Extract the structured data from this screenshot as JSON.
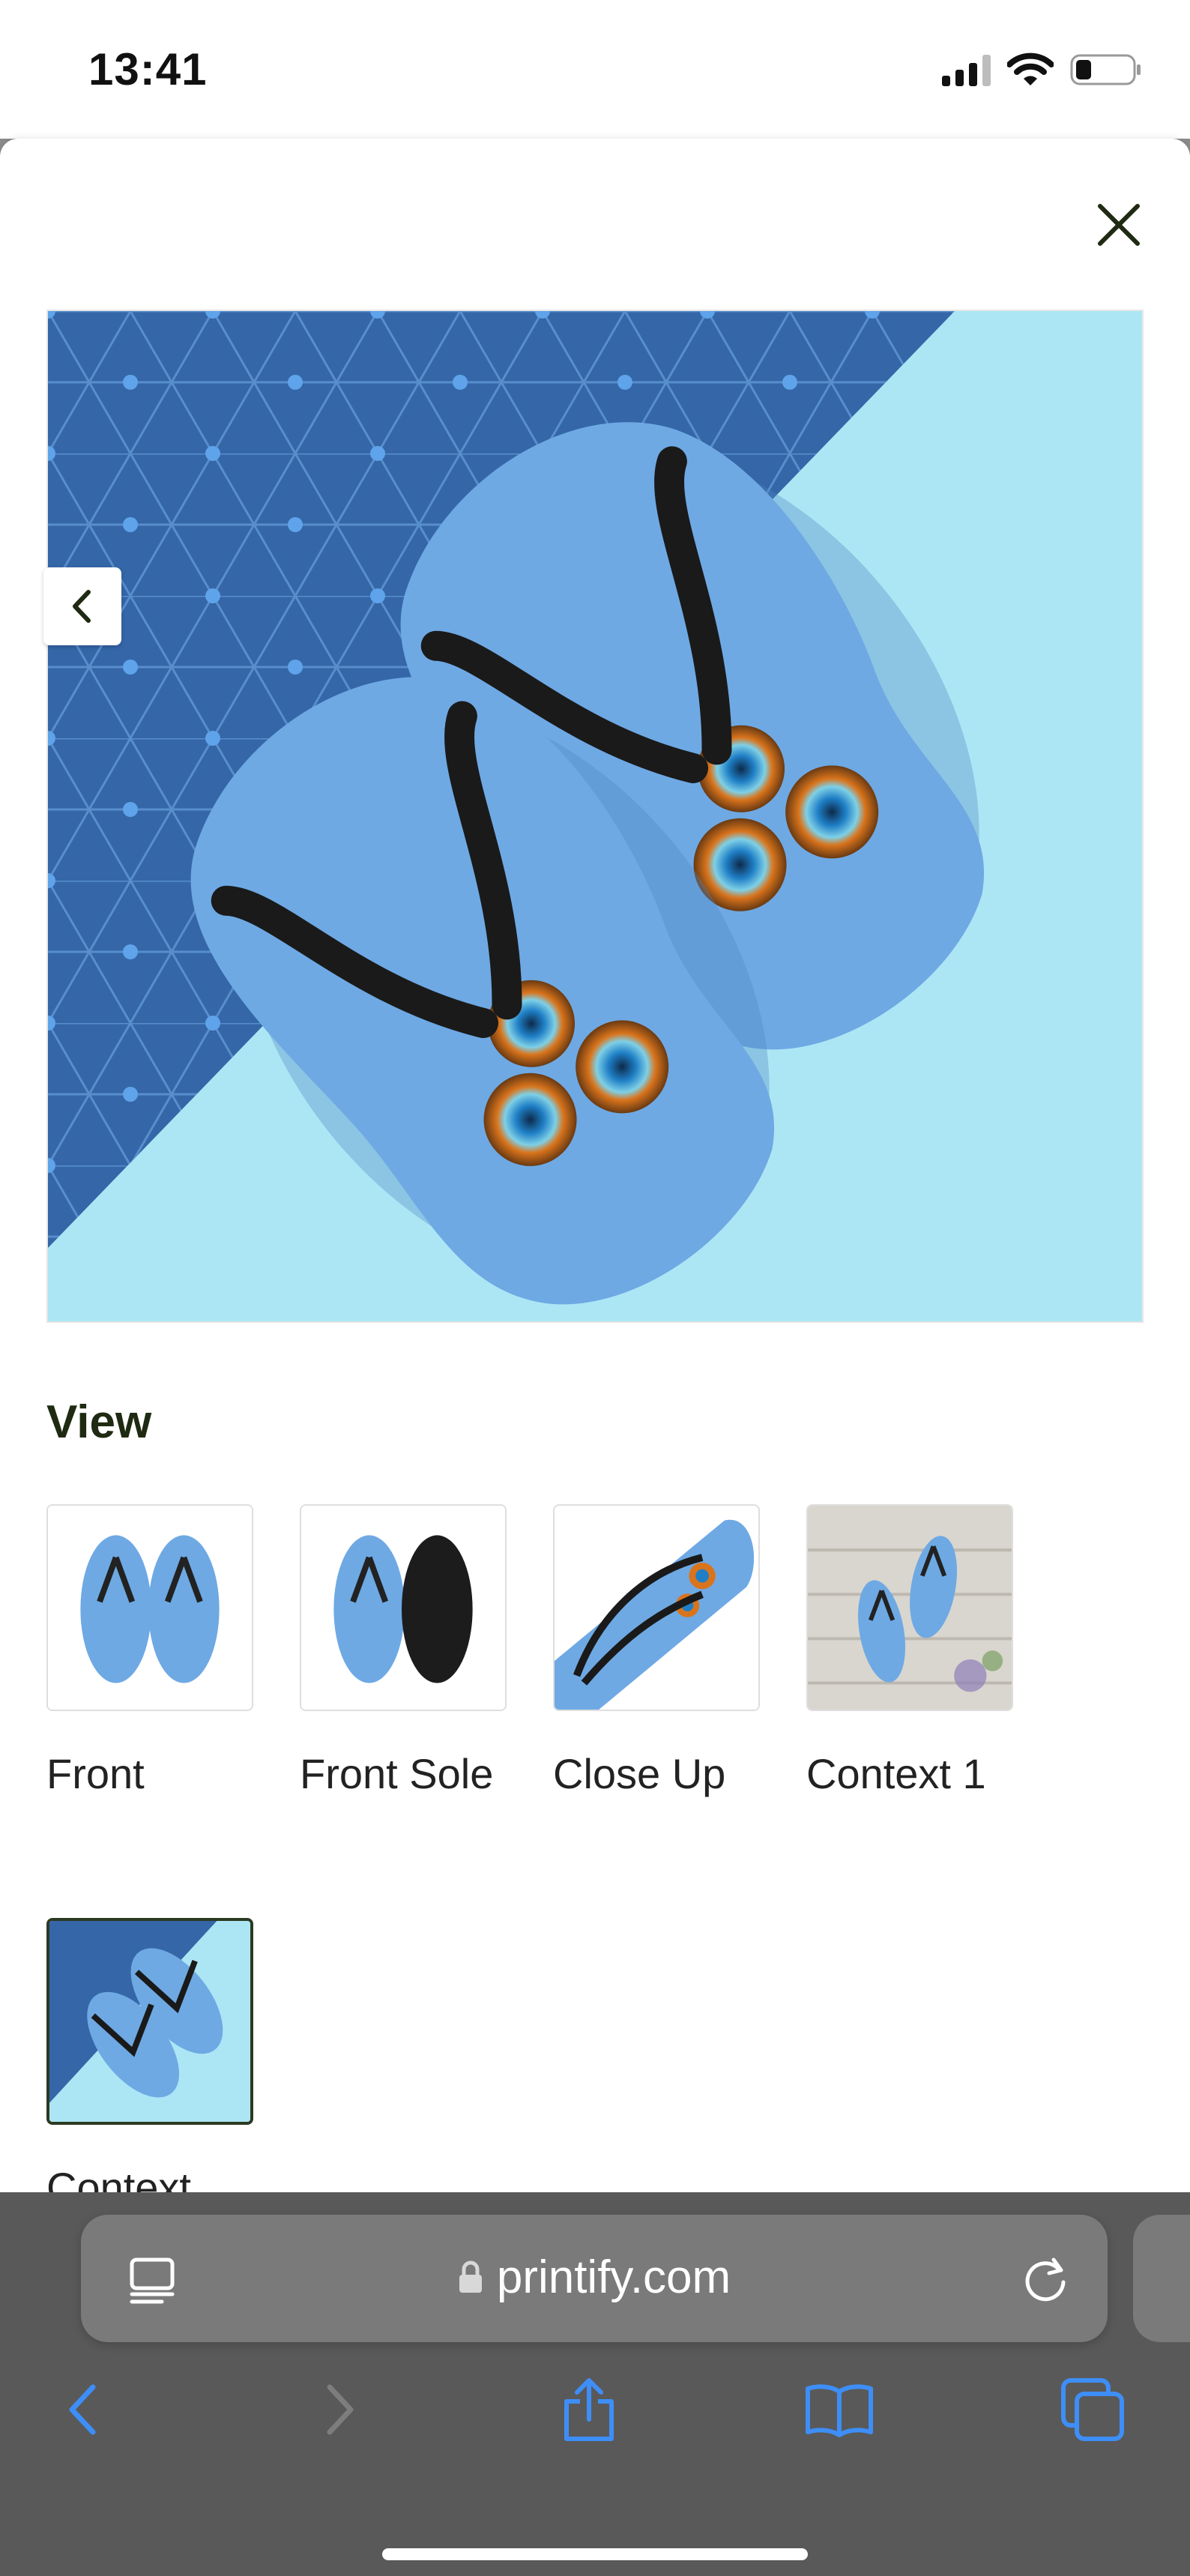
{
  "status_bar": {
    "time": "13:41"
  },
  "modal": {
    "main_image_alt": "Flip flops with peacock feather print",
    "view_heading": "View",
    "thumbnails": [
      {
        "label": "Front",
        "selected": false
      },
      {
        "label": "Front Sole",
        "selected": false
      },
      {
        "label": "Close Up",
        "selected": false
      },
      {
        "label": "Context 1",
        "selected": false
      },
      {
        "label": "Context",
        "selected": true
      }
    ]
  },
  "browser": {
    "url": "printify.com"
  },
  "icons": {
    "close": "close-icon",
    "prev": "chevron-left-icon",
    "lock": "lock-icon",
    "reader": "reader-mode-icon",
    "reload": "reload-icon",
    "back": "back-arrow-icon",
    "forward": "forward-arrow-icon",
    "share": "share-icon",
    "bookmarks": "bookmarks-icon",
    "tabs": "tabs-icon"
  },
  "colors": {
    "accent_blue": "#3e8ef7",
    "sole_blue": "#6ea9e4",
    "sky_bg": "#ace6f5",
    "pattern_bg": "#3466a8"
  }
}
